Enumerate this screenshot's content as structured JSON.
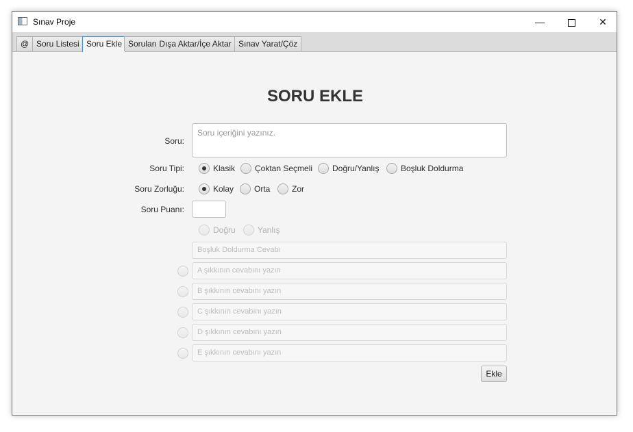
{
  "window": {
    "title": "Sınav Proje",
    "min_glyph": "—",
    "close_glyph": "✕"
  },
  "tabs": [
    {
      "label": "@"
    },
    {
      "label": "Soru Listesi"
    },
    {
      "label": "Soru Ekle"
    },
    {
      "label": "Soruları Dışa Aktar/İçe Aktar"
    },
    {
      "label": "Sınav Yarat/Çöz"
    }
  ],
  "active_tab": "Soru Ekle",
  "form": {
    "heading": "SORU EKLE",
    "soru_label": "Soru:",
    "soru_placeholder": "Soru içeriğini yazınız.",
    "tip_label": "Soru Tipi:",
    "tip_options": [
      "Klasik",
      "Çoktan Seçmeli",
      "Doğru/Yanlış",
      "Boşluk Doldurma"
    ],
    "tip_selected": "Klasik",
    "zorluk_label": "Soru Zorluğu:",
    "zorluk_options": [
      "Kolay",
      "Orta",
      "Zor"
    ],
    "zorluk_selected": "Kolay",
    "puan_label": "Soru Puanı:",
    "puan_value": "",
    "dogru_yanlis": [
      "Doğru",
      "Yanlış"
    ],
    "bosluk_placeholder": "Boşluk Doldurma Cevabı",
    "choices": [
      "A şıkkının cevabını yazın",
      "B şıkkının cevabını yazın",
      "C şıkkının cevabını yazın",
      "D şıkkının cevabını yazın",
      "E şıkkının cevabını yazın"
    ],
    "submit_label": "Ekle"
  }
}
